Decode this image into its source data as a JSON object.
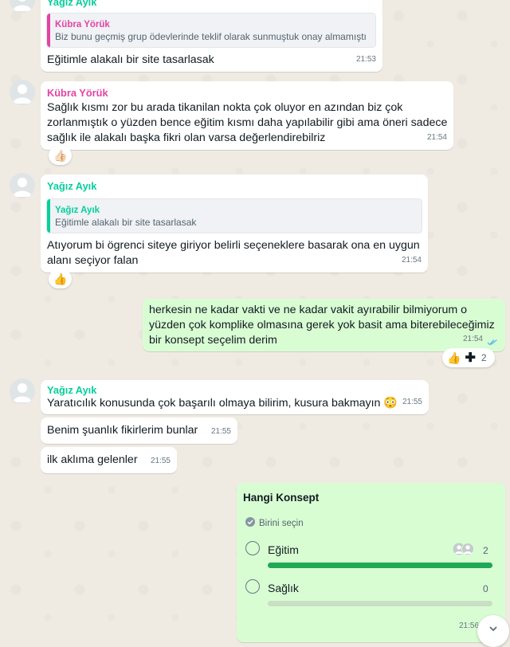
{
  "colors": {
    "chat_bg": "#efeae2",
    "incoming": "#ffffff",
    "outgoing": "#d9fdd3",
    "sender_yagiz": "#06cf9c",
    "sender_kubra": "#e542a3",
    "poll_bar": "#1fa855",
    "read_ticks": "#53bdeb"
  },
  "messages": {
    "m1": {
      "sender": "Yağız Ayık",
      "quote_sender": "Kübra Yörük",
      "quote_text": "Biz bunu geçmiş grup ödevlerinde teklif olarak sunmuştuk onay almamıştı",
      "text": "Eğitimle alakalı bir site tasarlasak",
      "time": "21:53"
    },
    "m2": {
      "sender": "Kübra Yörük",
      "lines": [
        "Sağlık kısmı zor bu arada tikanilan nokta çok oluyor en azından biz çok",
        "zorlanmıştık o yüzden bence eğitim kısmı daha yapılabilir gibi ama öneri sadece",
        "sağlık ile alakalı başka fikri olan varsa değerlendirebilriz"
      ],
      "time": "21:54",
      "reaction": "👍🏻"
    },
    "m3": {
      "sender": "Yağız Ayık",
      "quote_sender": "Yağız Ayık",
      "quote_text": "Eğitimle alakalı bir site tasarlasak",
      "lines": [
        "Atıyorum bi ögrenci siteye giriyor belirli seçeneklere basarak ona en uygun",
        "alanı seçiyor falan"
      ],
      "time": "21:54",
      "reaction": "👍"
    },
    "m4": {
      "lines": [
        "herkesin ne kadar vakti ve ne kadar vakit ayırabilir bilmiyorum o",
        "yüzden çok komplike olmasına gerek yok basit ama biterebileceğimiz",
        "bir konsept seçelim derim"
      ],
      "time": "21:54",
      "reaction": "👍",
      "reaction_count": "2"
    },
    "m5": {
      "sender": "Yağız Ayık",
      "text": "Yaratıcılık konusunda çok başarılı olmaya bilirim, kusura bakmayın 😳",
      "time": "21:55"
    },
    "m6": {
      "text": "Benim şuanlık fikirlerim bunlar",
      "time": "21:55"
    },
    "m7": {
      "text": "ilk aklıma gelenler",
      "time": "21:55"
    }
  },
  "poll": {
    "title": "Hangi Konsept",
    "hint": "Birini seçin",
    "options": [
      {
        "label": "Eğitim",
        "votes": "2",
        "fraction": 1.0
      },
      {
        "label": "Sağlık",
        "votes": "0",
        "fraction": 0.0
      }
    ],
    "time": "21:56"
  }
}
